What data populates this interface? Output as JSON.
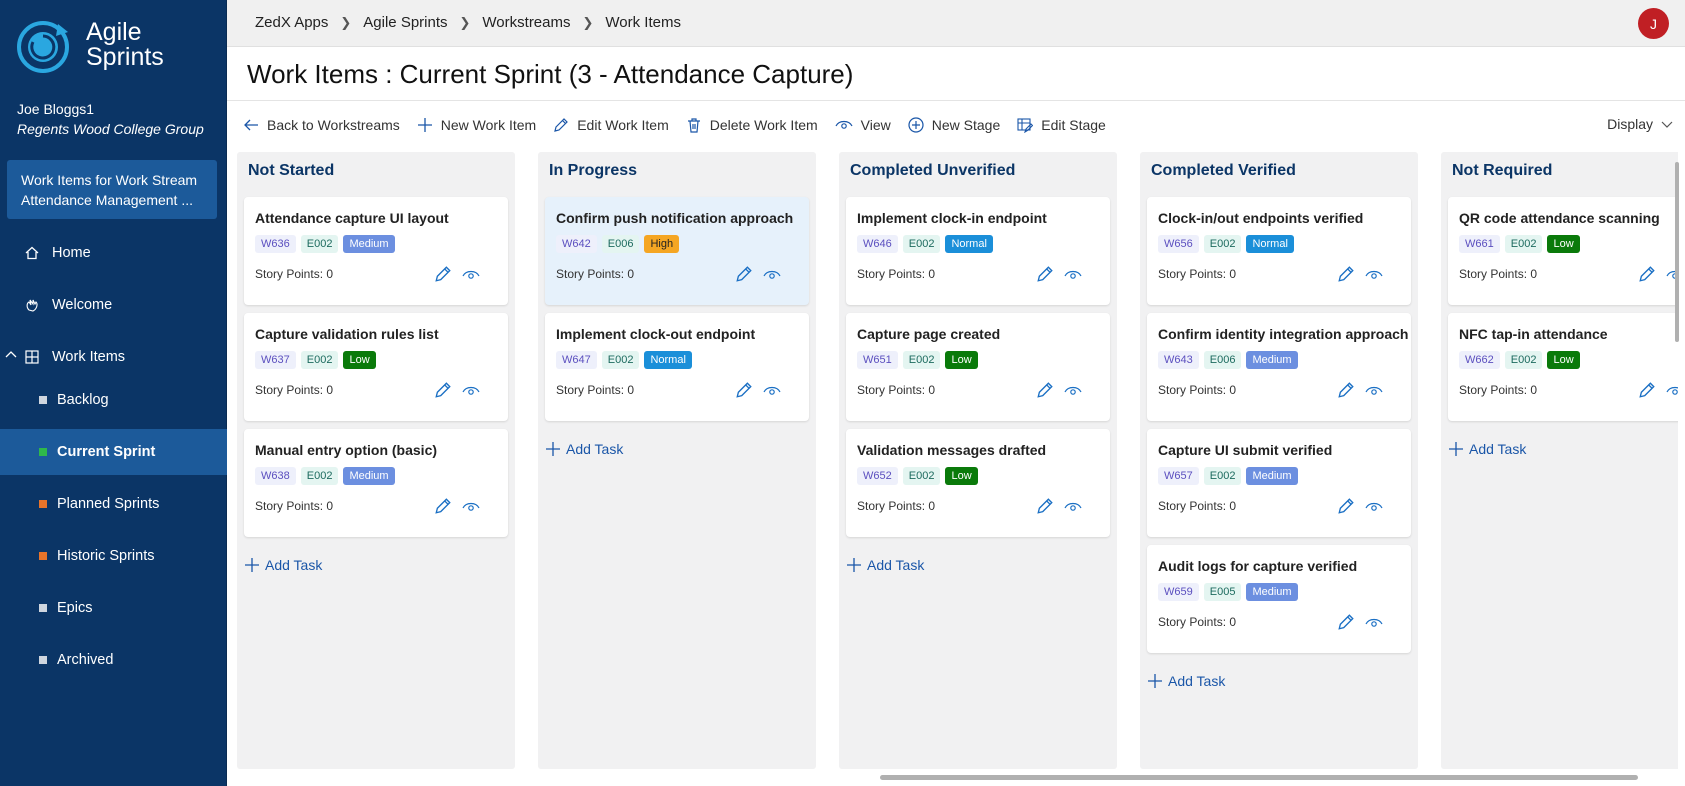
{
  "app": {
    "logo_line1": "Agile",
    "logo_line2": "Sprints"
  },
  "user": {
    "name": "Joe Bloggs1",
    "org": "Regents Wood College Group",
    "avatar_initial": "J"
  },
  "sidebar": {
    "workstream_box_line1": "Work Items for Work Stream",
    "workstream_box_line2": "Attendance Management ...",
    "items": [
      {
        "label": "Home"
      },
      {
        "label": "Welcome"
      },
      {
        "label": "Work Items"
      },
      {
        "label": "Backlog",
        "dot": "#cfd6df"
      },
      {
        "label": "Current Sprint",
        "dot": "#2fb84a"
      },
      {
        "label": "Planned Sprints",
        "dot": "#e8742a"
      },
      {
        "label": "Historic Sprints",
        "dot": "#e8742a"
      },
      {
        "label": "Epics",
        "dot": "#cfd6df"
      },
      {
        "label": "Archived",
        "dot": "#cfd6df"
      }
    ]
  },
  "breadcrumb": [
    "ZedX Apps",
    "Agile Sprints",
    "Workstreams",
    "Work Items"
  ],
  "page_title": "Work Items : Current Sprint (3 - Attendance Capture)",
  "toolbar": {
    "back": "Back to Workstreams",
    "new_item": "New Work Item",
    "edit_item": "Edit Work Item",
    "delete_item": "Delete Work Item",
    "view": "View",
    "new_stage": "New Stage",
    "edit_stage": "Edit Stage",
    "display": "Display"
  },
  "board": {
    "story_points_label": "Story Points:",
    "add_task_label": "Add Task",
    "columns": [
      {
        "title": "Not Started",
        "cards": [
          {
            "title": "Attendance capture UI layout",
            "wid": "W636",
            "eid": "E002",
            "priority": "Medium",
            "points": "0"
          },
          {
            "title": "Capture validation rules list",
            "wid": "W637",
            "eid": "E002",
            "priority": "Low",
            "points": "0"
          },
          {
            "title": "Manual entry option (basic)",
            "wid": "W638",
            "eid": "E002",
            "priority": "Medium",
            "points": "0"
          }
        ]
      },
      {
        "title": "In Progress",
        "cards": [
          {
            "title": "Confirm push notification approach",
            "wid": "W642",
            "eid": "E006",
            "priority": "High",
            "points": "0"
          },
          {
            "title": "Implement clock-out endpoint",
            "wid": "W647",
            "eid": "E002",
            "priority": "Normal",
            "points": "0"
          }
        ]
      },
      {
        "title": "Completed Unverified",
        "cards": [
          {
            "title": "Implement clock-in endpoint",
            "wid": "W646",
            "eid": "E002",
            "priority": "Normal",
            "points": "0"
          },
          {
            "title": "Capture page created",
            "wid": "W651",
            "eid": "E002",
            "priority": "Low",
            "points": "0"
          },
          {
            "title": "Validation messages drafted",
            "wid": "W652",
            "eid": "E002",
            "priority": "Low",
            "points": "0"
          }
        ]
      },
      {
        "title": "Completed Verified",
        "cards": [
          {
            "title": "Clock-in/out endpoints verified",
            "wid": "W656",
            "eid": "E002",
            "priority": "Normal",
            "points": "0"
          },
          {
            "title": "Confirm identity integration approach",
            "wid": "W643",
            "eid": "E006",
            "priority": "Medium",
            "points": "0"
          },
          {
            "title": "Capture UI submit verified",
            "wid": "W657",
            "eid": "E002",
            "priority": "Medium",
            "points": "0"
          },
          {
            "title": "Audit logs for capture verified",
            "wid": "W659",
            "eid": "E005",
            "priority": "Medium",
            "points": "0"
          }
        ]
      },
      {
        "title": "Not Required",
        "cards": [
          {
            "title": "QR code attendance scanning",
            "wid": "W661",
            "eid": "E002",
            "priority": "Low",
            "points": "0"
          },
          {
            "title": "NFC tap-in attendance",
            "wid": "W662",
            "eid": "E002",
            "priority": "Low",
            "points": "0"
          }
        ]
      }
    ]
  }
}
